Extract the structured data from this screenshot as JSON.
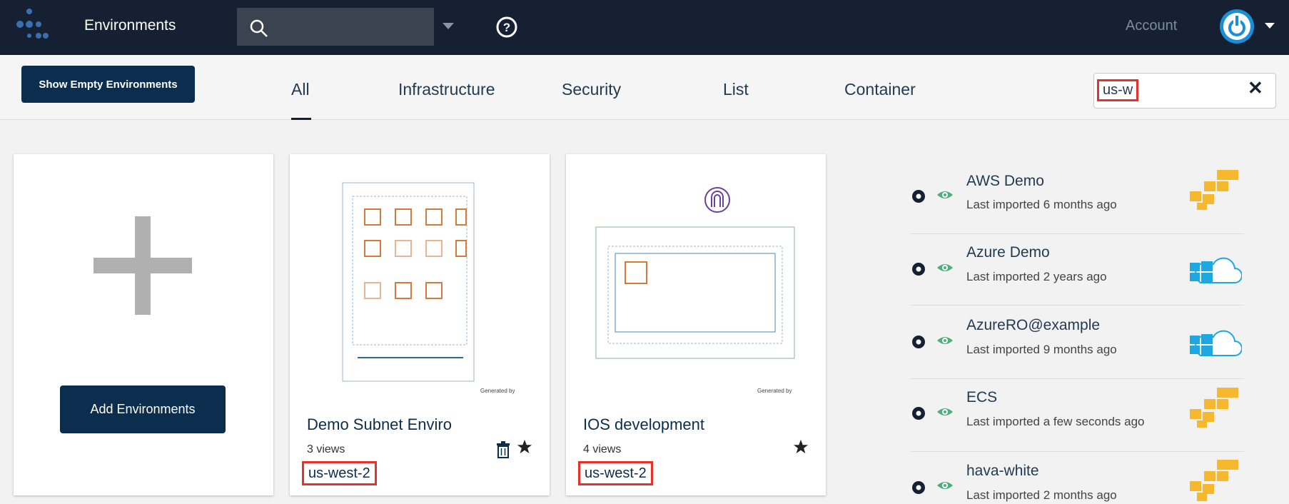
{
  "header": {
    "app_title": "Environments",
    "account_label": "Account",
    "search_value": "",
    "icons": [
      "logo-icon",
      "search-icon",
      "chevron-down-icon",
      "help-icon",
      "power-icon"
    ]
  },
  "toolbar": {
    "show_empty_label": "Show Empty Environments",
    "tabs": [
      {
        "label": "All",
        "active": true
      },
      {
        "label": "Infrastructure"
      },
      {
        "label": "Security"
      },
      {
        "label": "List"
      },
      {
        "label": "Container"
      }
    ],
    "filter_value": "us-w",
    "clear_icon": "✕"
  },
  "cards": {
    "add_label": "Add Environments",
    "items": [
      {
        "title": "Demo Subnet Enviro",
        "views": "3 views",
        "region": "us-west-2",
        "generated_by": "Generated by"
      },
      {
        "title": "IOS development",
        "views": "4 views",
        "region": "us-west-2",
        "generated_by": "Generated by"
      }
    ]
  },
  "environments": [
    {
      "name": "AWS Demo",
      "imported": "Last imported 6 months ago",
      "provider": "aws"
    },
    {
      "name": "Azure Demo",
      "imported": "Last imported 2 years ago",
      "provider": "azure"
    },
    {
      "name": "AzureRO@example",
      "imported": "Last imported 9 months ago",
      "provider": "azure"
    },
    {
      "name": "ECS",
      "imported": "Last imported a few seconds ago",
      "provider": "aws"
    },
    {
      "name": "hava-white",
      "imported": "Last imported 2 months ago",
      "provider": "aws"
    }
  ],
  "colors": {
    "navy": "#152033",
    "button": "#0b2e4f",
    "highlight": "#e5322d",
    "aws": "#f5b82e",
    "azure": "#1ea7e1",
    "eye": "#4caf7d"
  }
}
